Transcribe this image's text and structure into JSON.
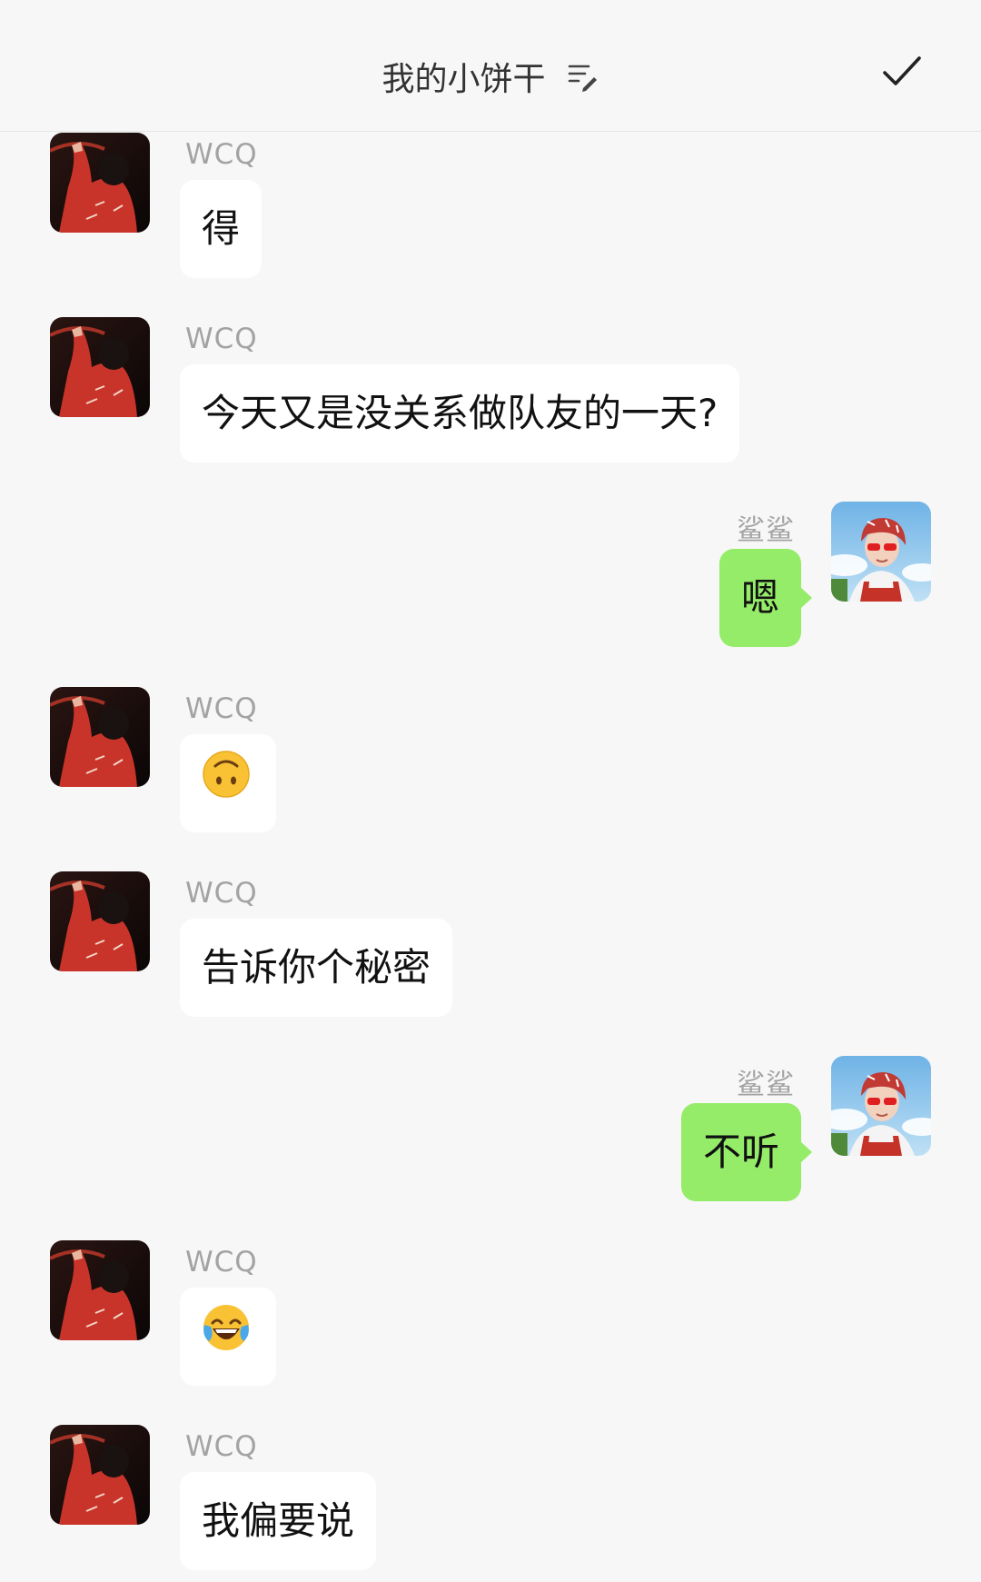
{
  "header": {
    "title": "我的小饼干",
    "edit_icon": "edit-list-icon",
    "done_icon": "checkmark-icon"
  },
  "colors": {
    "background": "#f7f7f7",
    "incoming_bubble": "#ffffff",
    "outgoing_bubble": "#95ec69",
    "sender_name": "#a3a3a3"
  },
  "messages": [
    {
      "sender": "WCQ",
      "side": "left",
      "text": "得"
    },
    {
      "sender": "WCQ",
      "side": "left",
      "text": "今天又是没关系做队友的一天?"
    },
    {
      "sender": "鲨鲨",
      "side": "right",
      "text": "嗯"
    },
    {
      "sender": "WCQ",
      "side": "left",
      "emoji": "upside-down-face-emoji"
    },
    {
      "sender": "WCQ",
      "side": "left",
      "text": "告诉你个秘密"
    },
    {
      "sender": "鲨鲨",
      "side": "right",
      "text": "不听"
    },
    {
      "sender": "WCQ",
      "side": "left",
      "emoji": "tears-of-joy-emoji"
    },
    {
      "sender": "WCQ",
      "side": "left",
      "text": "我偏要说"
    }
  ]
}
